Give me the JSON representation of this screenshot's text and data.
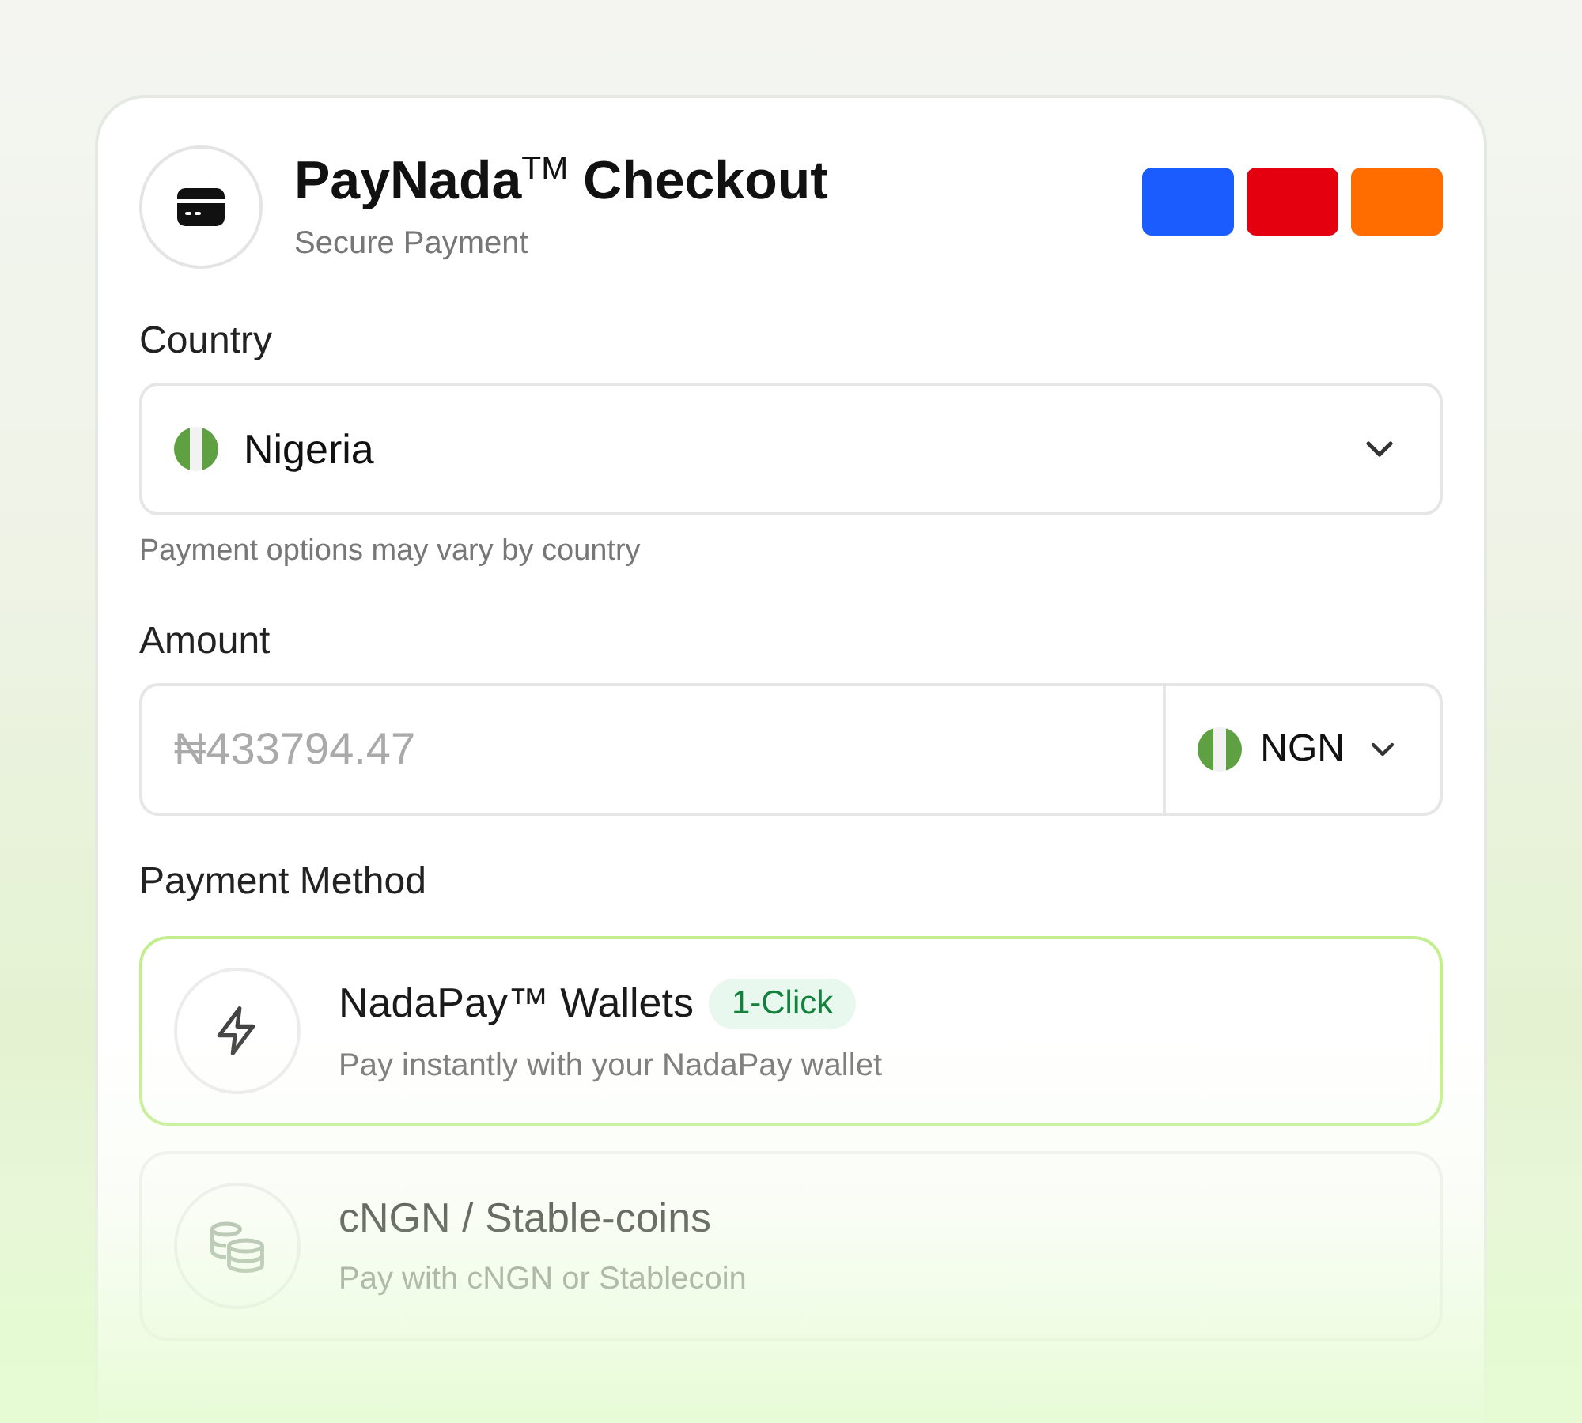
{
  "header": {
    "title": "PayNada$^{TM}$ Checkout",
    "subtitle": "Secure Payment",
    "brand_swatches": [
      {
        "color": "#1a5cff"
      },
      {
        "color": "#e5000f"
      },
      {
        "color": "#ff6d00"
      }
    ]
  },
  "country": {
    "label": "Country",
    "value": "Nigeria",
    "hint": "Payment options may vary by country"
  },
  "amount": {
    "label": "Amount",
    "placeholder": "₦433794.47",
    "currency": "NGN"
  },
  "payment_method": {
    "label": "Payment Method",
    "options": [
      {
        "kind": "wallet",
        "title": "NadaPay™ Wallets",
        "badge": "1-Click",
        "description": "Pay instantly with your NadaPay wallet",
        "selected": true
      },
      {
        "kind": "coins",
        "title": "cNGN / Stable-coins",
        "description": "Pay with cNGN or Stablecoin",
        "selected": false
      }
    ]
  }
}
